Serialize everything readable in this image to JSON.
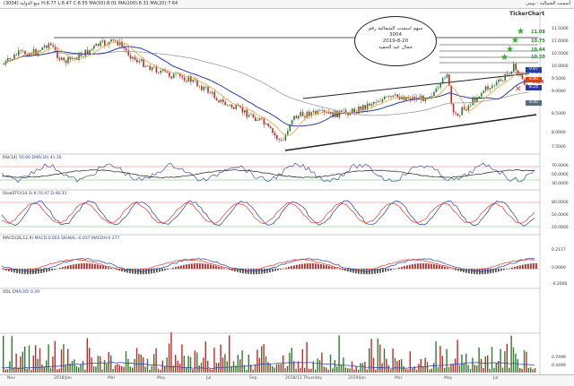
{
  "header": {
    "left": "بنبع الدولية (3004) H:8.77 L:8.47 C:8.55 MA(50):8.01 MA(200):8.31 MA(20):7.64",
    "right": "أسمنت الشمالية - يومي"
  },
  "logo": "TickerChart",
  "bubble": [
    "سهم اسمنت الشمالية رقم",
    "3004",
    "2019-8-20",
    "جمال عبد الحميد"
  ],
  "targets": [
    "11.08",
    "10.75",
    "10.44",
    "10.20",
    "9.85"
  ],
  "price_tags": [
    {
      "v": "9.87",
      "c": "#2a3ea0"
    },
    {
      "v": "8.80",
      "c": "#d84315"
    },
    {
      "v": "8.24",
      "c": "#2a3ea0"
    },
    {
      "v": "8.00",
      "c": "#546e7a"
    }
  ],
  "price_axis": [
    "11.5000",
    "11.0000",
    "10.5000",
    "10.0000",
    "9.5000",
    "9.0000",
    "8.5000",
    "8.0000",
    "7.5000"
  ],
  "stop": "9.34",
  "panels": {
    "rsi": {
      "label": "RSI(14)",
      "extra": "50.00  EMA(30)  41.16",
      "levels": [
        "70.0000",
        "50.0000",
        "30.0000"
      ]
    },
    "stoch": {
      "label": "SlowSTO(14,3)",
      "extra": "K:70.47  D:48.33",
      "levels": [
        "80.0000",
        "50.0000",
        "20.0000"
      ]
    },
    "macd": {
      "label": "MACD(26,12,9)",
      "extra": "MACD:0.003  SIGNAL:-0.037  MACDH:0.377",
      "levels": [
        "0.2117",
        "0.0000",
        "-0.2000"
      ]
    },
    "vol": {
      "label": "VOL",
      "extra": "EMA(30)  0.39",
      "levels": [
        "0.7499",
        "0.4499"
      ]
    }
  },
  "x_axis": [
    "Nov",
    "2018/Jan",
    "Mar",
    "May",
    "Jul",
    "Sep",
    "2018/11 Thursday",
    "2019/Jan",
    "Mar",
    "May",
    "Jul"
  ],
  "colors": {
    "up": "#2e7d32",
    "down": "#c62828",
    "ma_fast": "#e8a33c",
    "ma_mid": "#2a3ea0",
    "ma_slow": "#9e9e9e",
    "signal": "#e53935"
  }
}
